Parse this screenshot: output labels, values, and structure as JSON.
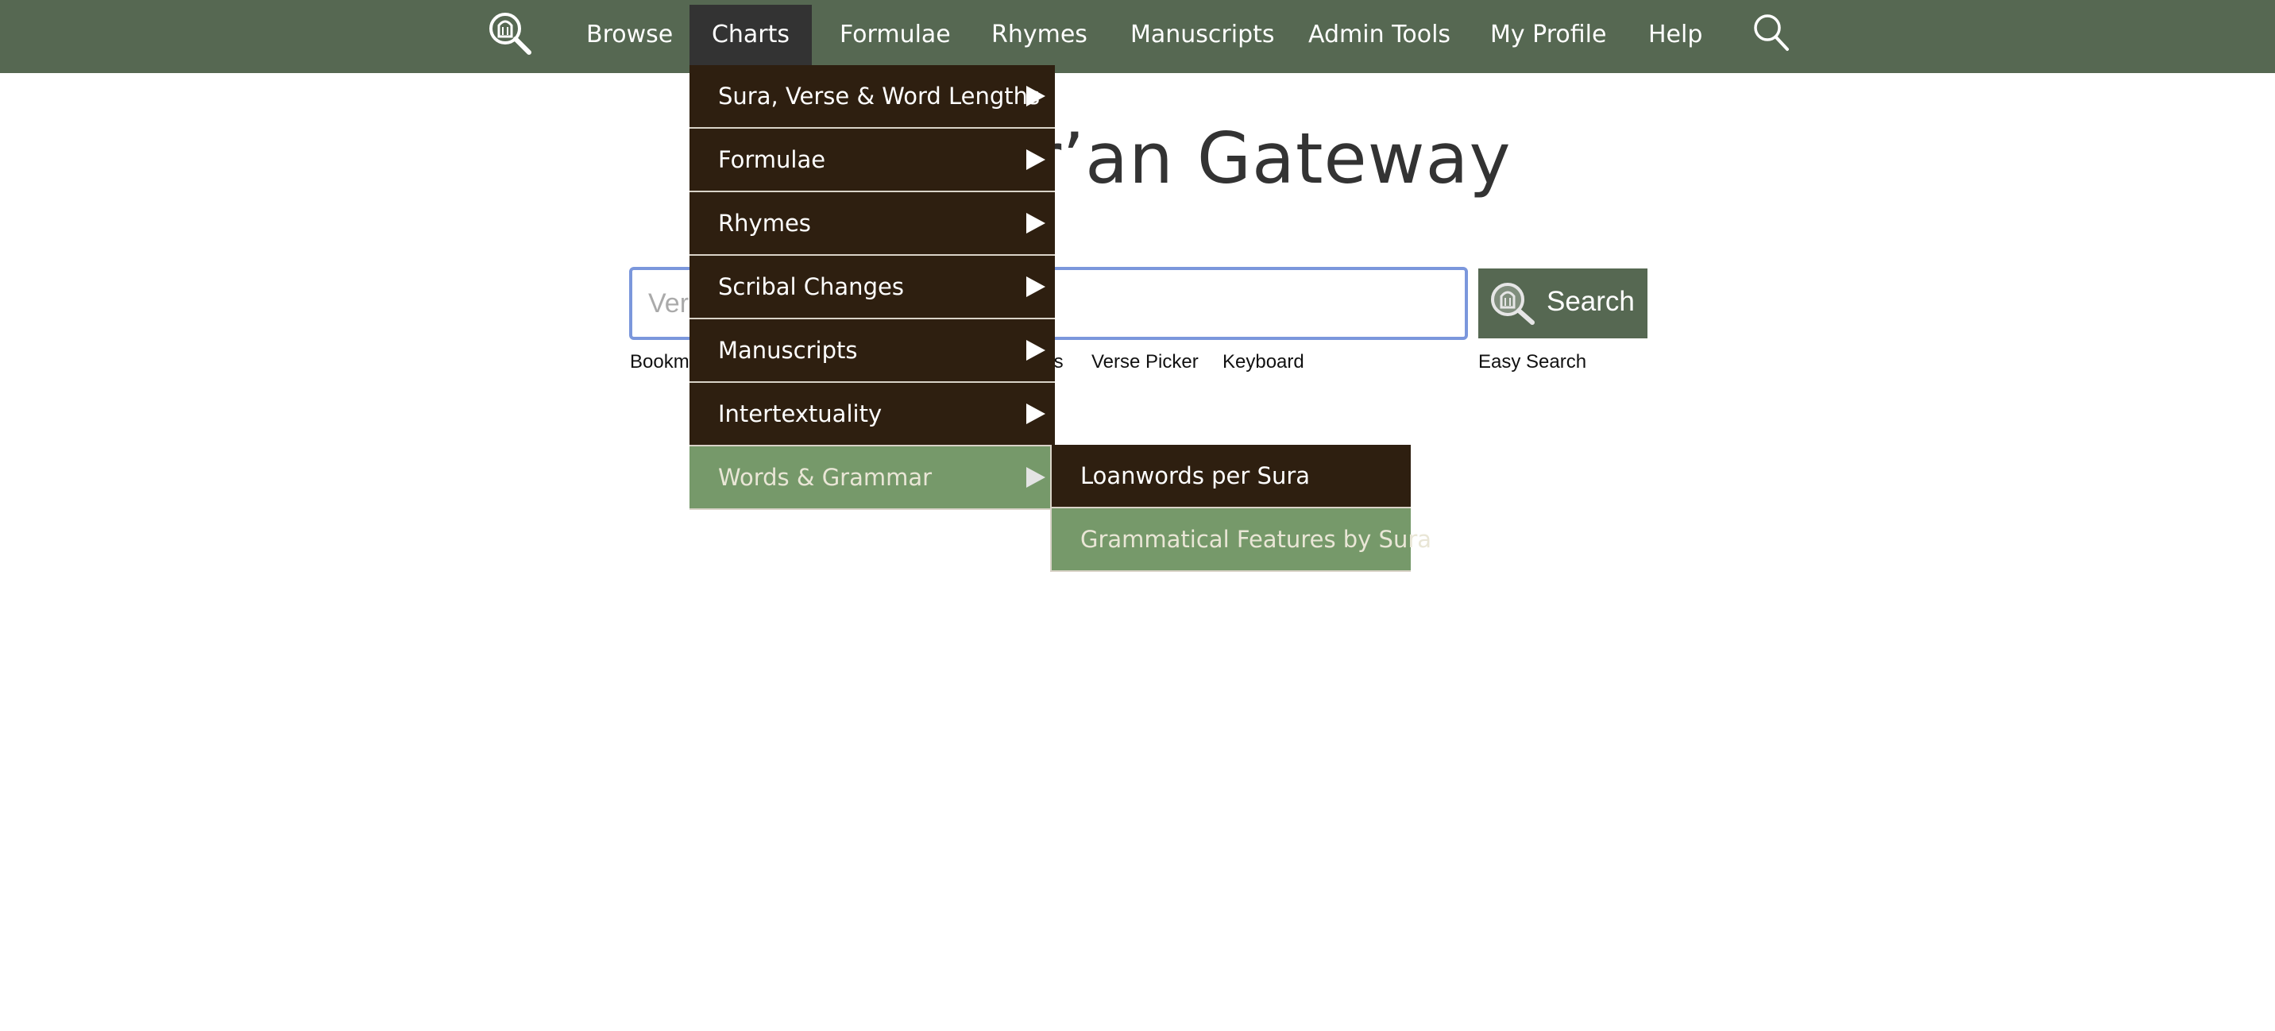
{
  "nav": {
    "items": [
      {
        "label": "Browse"
      },
      {
        "label": "Charts"
      },
      {
        "label": "Formulae"
      },
      {
        "label": "Rhymes"
      },
      {
        "label": "Manuscripts"
      },
      {
        "label": "Admin Tools"
      },
      {
        "label": "My Profile"
      },
      {
        "label": "Help"
      }
    ],
    "active_item": "Charts",
    "logo_icon": "magnifier-manuscript-icon",
    "search_icon": "search-icon"
  },
  "site_logo_text": "r’an Gateway",
  "search": {
    "placeholder": "Ver",
    "button_label": "Search",
    "links": [
      "Bookm",
      "ts",
      "Verse Picker",
      "Keyboard"
    ],
    "easy_search": "Easy Search"
  },
  "charts_menu": {
    "items": [
      {
        "label": "Sura, Verse & Word Lengths"
      },
      {
        "label": "Formulae"
      },
      {
        "label": "Rhymes"
      },
      {
        "label": "Scribal Changes"
      },
      {
        "label": "Manuscripts"
      },
      {
        "label": "Intertextuality"
      },
      {
        "label": "Words & Grammar"
      }
    ],
    "highlighted": "Words & Grammar",
    "submenu": [
      {
        "label": "Loanwords per Sura"
      },
      {
        "label": "Grammatical Features by Sura"
      }
    ],
    "submenu_highlighted": "Grammatical Features by Sura"
  },
  "colors": {
    "nav_bg": "#566852",
    "menu_bg": "#2e1f10",
    "menu_hover": "#76996a",
    "active_tab": "#333333",
    "input_border": "#7b97dc"
  }
}
